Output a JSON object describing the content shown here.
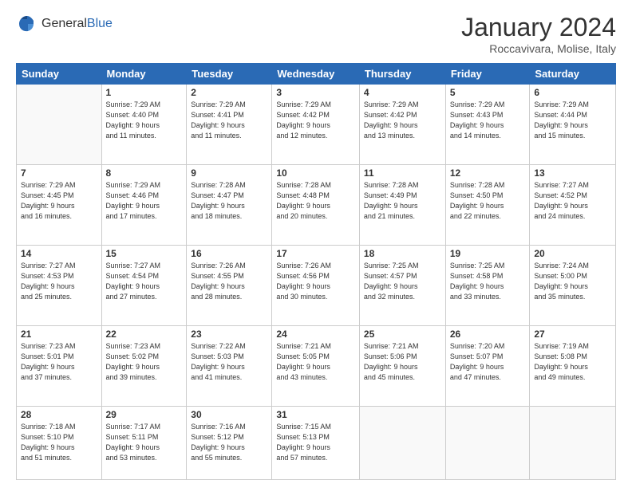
{
  "logo": {
    "general": "General",
    "blue": "Blue"
  },
  "title": "January 2024",
  "subtitle": "Roccavivara, Molise, Italy",
  "weekdays": [
    "Sunday",
    "Monday",
    "Tuesday",
    "Wednesday",
    "Thursday",
    "Friday",
    "Saturday"
  ],
  "weeks": [
    [
      {
        "day": "",
        "info": ""
      },
      {
        "day": "1",
        "info": "Sunrise: 7:29 AM\nSunset: 4:40 PM\nDaylight: 9 hours\nand 11 minutes."
      },
      {
        "day": "2",
        "info": "Sunrise: 7:29 AM\nSunset: 4:41 PM\nDaylight: 9 hours\nand 11 minutes."
      },
      {
        "day": "3",
        "info": "Sunrise: 7:29 AM\nSunset: 4:42 PM\nDaylight: 9 hours\nand 12 minutes."
      },
      {
        "day": "4",
        "info": "Sunrise: 7:29 AM\nSunset: 4:42 PM\nDaylight: 9 hours\nand 13 minutes."
      },
      {
        "day": "5",
        "info": "Sunrise: 7:29 AM\nSunset: 4:43 PM\nDaylight: 9 hours\nand 14 minutes."
      },
      {
        "day": "6",
        "info": "Sunrise: 7:29 AM\nSunset: 4:44 PM\nDaylight: 9 hours\nand 15 minutes."
      }
    ],
    [
      {
        "day": "7",
        "info": "Sunrise: 7:29 AM\nSunset: 4:45 PM\nDaylight: 9 hours\nand 16 minutes."
      },
      {
        "day": "8",
        "info": "Sunrise: 7:29 AM\nSunset: 4:46 PM\nDaylight: 9 hours\nand 17 minutes."
      },
      {
        "day": "9",
        "info": "Sunrise: 7:28 AM\nSunset: 4:47 PM\nDaylight: 9 hours\nand 18 minutes."
      },
      {
        "day": "10",
        "info": "Sunrise: 7:28 AM\nSunset: 4:48 PM\nDaylight: 9 hours\nand 20 minutes."
      },
      {
        "day": "11",
        "info": "Sunrise: 7:28 AM\nSunset: 4:49 PM\nDaylight: 9 hours\nand 21 minutes."
      },
      {
        "day": "12",
        "info": "Sunrise: 7:28 AM\nSunset: 4:50 PM\nDaylight: 9 hours\nand 22 minutes."
      },
      {
        "day": "13",
        "info": "Sunrise: 7:27 AM\nSunset: 4:52 PM\nDaylight: 9 hours\nand 24 minutes."
      }
    ],
    [
      {
        "day": "14",
        "info": "Sunrise: 7:27 AM\nSunset: 4:53 PM\nDaylight: 9 hours\nand 25 minutes."
      },
      {
        "day": "15",
        "info": "Sunrise: 7:27 AM\nSunset: 4:54 PM\nDaylight: 9 hours\nand 27 minutes."
      },
      {
        "day": "16",
        "info": "Sunrise: 7:26 AM\nSunset: 4:55 PM\nDaylight: 9 hours\nand 28 minutes."
      },
      {
        "day": "17",
        "info": "Sunrise: 7:26 AM\nSunset: 4:56 PM\nDaylight: 9 hours\nand 30 minutes."
      },
      {
        "day": "18",
        "info": "Sunrise: 7:25 AM\nSunset: 4:57 PM\nDaylight: 9 hours\nand 32 minutes."
      },
      {
        "day": "19",
        "info": "Sunrise: 7:25 AM\nSunset: 4:58 PM\nDaylight: 9 hours\nand 33 minutes."
      },
      {
        "day": "20",
        "info": "Sunrise: 7:24 AM\nSunset: 5:00 PM\nDaylight: 9 hours\nand 35 minutes."
      }
    ],
    [
      {
        "day": "21",
        "info": "Sunrise: 7:23 AM\nSunset: 5:01 PM\nDaylight: 9 hours\nand 37 minutes."
      },
      {
        "day": "22",
        "info": "Sunrise: 7:23 AM\nSunset: 5:02 PM\nDaylight: 9 hours\nand 39 minutes."
      },
      {
        "day": "23",
        "info": "Sunrise: 7:22 AM\nSunset: 5:03 PM\nDaylight: 9 hours\nand 41 minutes."
      },
      {
        "day": "24",
        "info": "Sunrise: 7:21 AM\nSunset: 5:05 PM\nDaylight: 9 hours\nand 43 minutes."
      },
      {
        "day": "25",
        "info": "Sunrise: 7:21 AM\nSunset: 5:06 PM\nDaylight: 9 hours\nand 45 minutes."
      },
      {
        "day": "26",
        "info": "Sunrise: 7:20 AM\nSunset: 5:07 PM\nDaylight: 9 hours\nand 47 minutes."
      },
      {
        "day": "27",
        "info": "Sunrise: 7:19 AM\nSunset: 5:08 PM\nDaylight: 9 hours\nand 49 minutes."
      }
    ],
    [
      {
        "day": "28",
        "info": "Sunrise: 7:18 AM\nSunset: 5:10 PM\nDaylight: 9 hours\nand 51 minutes."
      },
      {
        "day": "29",
        "info": "Sunrise: 7:17 AM\nSunset: 5:11 PM\nDaylight: 9 hours\nand 53 minutes."
      },
      {
        "day": "30",
        "info": "Sunrise: 7:16 AM\nSunset: 5:12 PM\nDaylight: 9 hours\nand 55 minutes."
      },
      {
        "day": "31",
        "info": "Sunrise: 7:15 AM\nSunset: 5:13 PM\nDaylight: 9 hours\nand 57 minutes."
      },
      {
        "day": "",
        "info": ""
      },
      {
        "day": "",
        "info": ""
      },
      {
        "day": "",
        "info": ""
      }
    ]
  ]
}
